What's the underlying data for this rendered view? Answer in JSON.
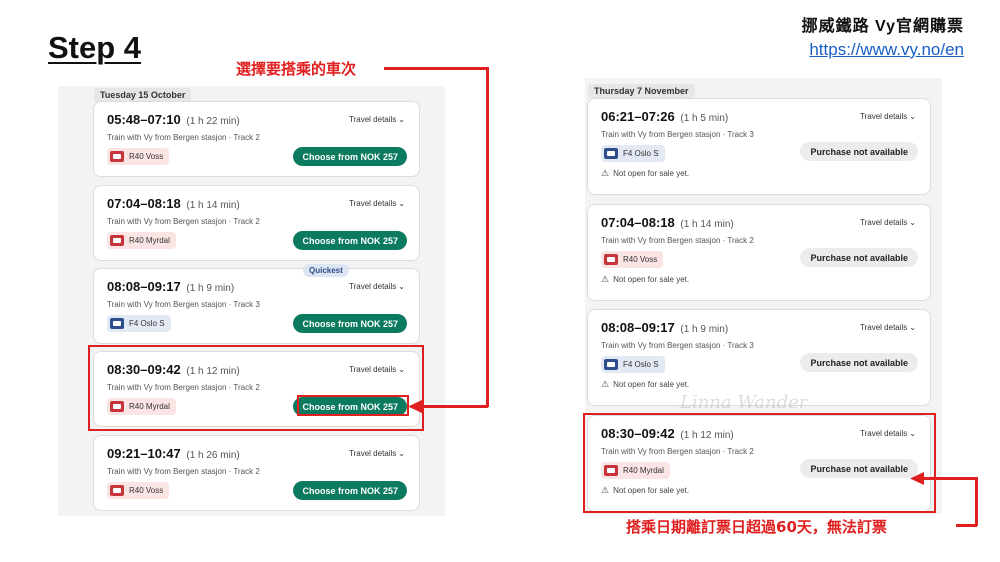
{
  "header": {
    "step": "Step 4",
    "brand_name": "挪威鐵路 Vy官網購票",
    "brand_url": "https://www.vy.no/en"
  },
  "annotations": {
    "select_train": "選擇要搭乘的車次",
    "over_60_days": "搭乘日期離訂票日超過60天，無法訂票"
  },
  "watermark": "Linna Wander",
  "left_panel": {
    "date": "Tuesday 15 October",
    "quickest_badge": "Quickest",
    "trains": [
      {
        "time": "05:48–07:10",
        "duration": "(1 h 22 min)",
        "desc": "Train with Vy from Bergen stasjon · Track 2",
        "details": "Travel details",
        "route": "R40 Voss",
        "button": "Choose from NOK 257"
      },
      {
        "time": "07:04–08:18",
        "duration": "(1 h 14 min)",
        "desc": "Train with Vy from Bergen stasjon · Track 2",
        "details": "Travel details",
        "route": "R40 Myrdal",
        "button": "Choose from NOK 257"
      },
      {
        "time": "08:08–09:17",
        "duration": "(1 h 9 min)",
        "desc": "Train with Vy from Bergen stasjon · Track 3",
        "details": "Travel details",
        "route": "F4 Oslo S",
        "button": "Choose from NOK 257"
      },
      {
        "time": "08:30–09:42",
        "duration": "(1 h 12 min)",
        "desc": "Train with Vy from Bergen stasjon · Track 2",
        "details": "Travel details",
        "route": "R40 Myrdal",
        "button": "Choose from NOK 257"
      },
      {
        "time": "09:21–10:47",
        "duration": "(1 h 26 min)",
        "desc": "Train with Vy from Bergen stasjon · Track 2",
        "details": "Travel details",
        "route": "R40 Voss",
        "button": "Choose from NOK 257"
      }
    ]
  },
  "right_panel": {
    "date": "Thursday 7 November",
    "trains": [
      {
        "time": "06:21–07:26",
        "duration": "(1 h 5 min)",
        "desc": "Train with Vy from Bergen stasjon · Track 3",
        "details": "Travel details",
        "route": "F4 Oslo S",
        "button": "Purchase not available",
        "note": "Not open for sale yet."
      },
      {
        "time": "07:04–08:18",
        "duration": "(1 h 14 min)",
        "desc": "Train with Vy from Bergen stasjon · Track 2",
        "details": "Travel details",
        "route": "R40 Voss",
        "button": "Purchase not available",
        "note": "Not open for sale yet."
      },
      {
        "time": "08:08–09:17",
        "duration": "(1 h 9 min)",
        "desc": "Train with Vy from Bergen stasjon · Track 3",
        "details": "Travel details",
        "route": "F4 Oslo S",
        "button": "Purchase not available",
        "note": "Not open for sale yet."
      },
      {
        "time": "08:30–09:42",
        "duration": "(1 h 12 min)",
        "desc": "Train with Vy from Bergen stasjon · Track 2",
        "details": "Travel details",
        "route": "R40 Myrdal",
        "button": "Purchase not available",
        "note": "Not open for sale yet."
      }
    ]
  },
  "colors": {
    "accent_red": "#e02020",
    "choose_green": "#0c7a5e",
    "regional_red": "#c7343a",
    "fjord_blue": "#2e4d8c",
    "link_blue": "#1a5fc6"
  }
}
